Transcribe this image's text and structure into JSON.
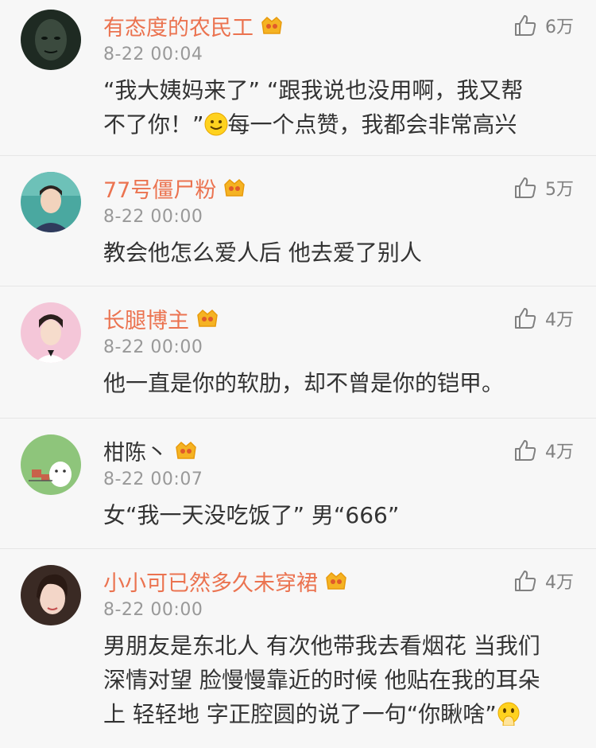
{
  "comments": [
    {
      "name": "有态度的农民工",
      "time": "8-22 00:04",
      "likes": "6万",
      "text_a": "“我大姨妈来了” “跟我说也没用啊，我又帮\n不了你！”",
      "emoji": "smile-emoji",
      "text_b": "每一个点赞，我都会非常高兴",
      "avatar": "dark-face-avatar"
    },
    {
      "name": "77号僵尸粉",
      "time": "8-22 00:00",
      "likes": "5万",
      "text": "教会他怎么爱人后  他去爱了别人",
      "avatar": "boy-teal-avatar"
    },
    {
      "name": "长腿博主",
      "time": "8-22 00:00",
      "likes": "4万",
      "text": "他一直是你的软肋，却不曾是你的铠甲。",
      "avatar": "boy-pink-avatar"
    },
    {
      "name": "柑陈丶",
      "time": "8-22 00:07",
      "likes": "4万",
      "text": "女“我一天没吃饭了” 男“666”",
      "avatar": "green-cat-avatar"
    },
    {
      "name": "小小可已然多久未穿裙",
      "time": "8-22 00:00",
      "likes": "4万",
      "text": "男朋友是东北人 有次他带我去看烟花 当我们\n深情对望 脸慢慢靠近的时候 他贴在我的耳朵\n上 轻轻地 字正腔圆的说了一句“你瞅啥”",
      "emoji": "hand-on-mouth-emoji",
      "avatar": "girl-dark-avatar"
    }
  ],
  "colors": {
    "name_accent": "#eb7350",
    "time": "#999999",
    "body_text": "#333333",
    "like": "#808080"
  }
}
